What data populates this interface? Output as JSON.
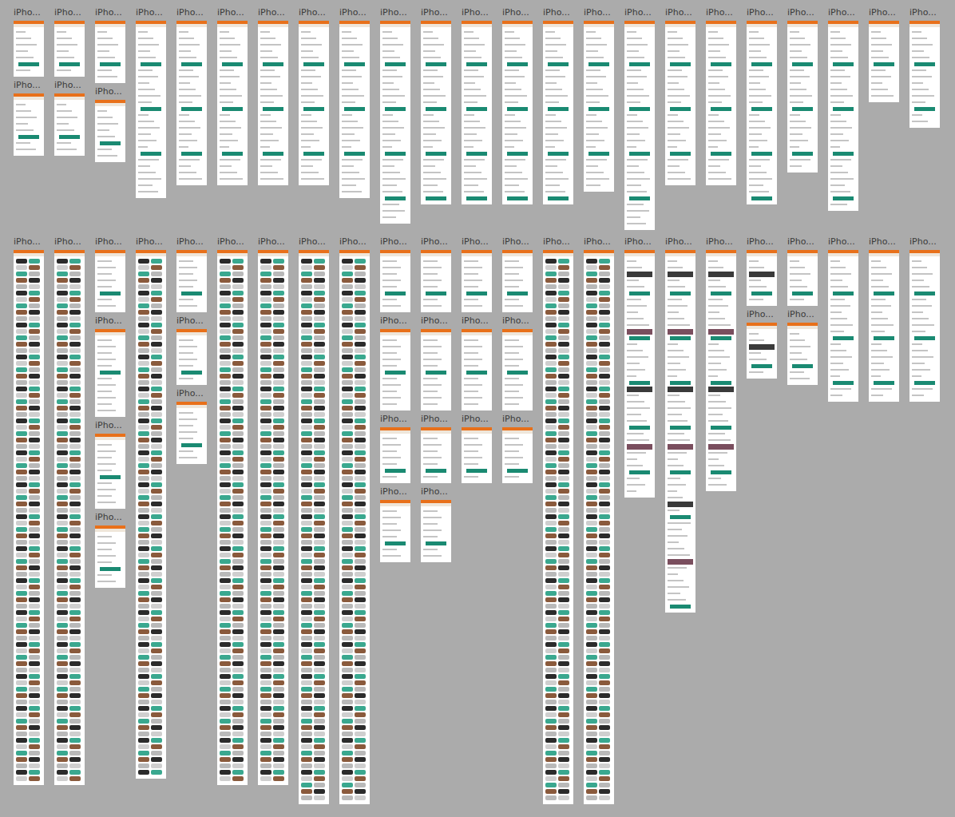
{
  "rows": [
    {
      "columns": [
        {
          "artboards": [
            {
              "label": "iPho...",
              "kind": "form",
              "items": 7
            },
            {
              "label": "iPho...",
              "kind": "form",
              "items": 8
            }
          ]
        },
        {
          "artboards": [
            {
              "label": "iPho...",
              "kind": "form",
              "items": 7
            },
            {
              "label": "iPho...",
              "kind": "form",
              "items": 8
            }
          ]
        },
        {
          "artboards": [
            {
              "label": "iPho...",
              "kind": "form",
              "items": 8
            },
            {
              "label": "iPho...",
              "kind": "form",
              "items": 8
            }
          ]
        },
        {
          "artboards": [
            {
              "label": "iPho...",
              "kind": "form",
              "items": 26
            }
          ]
        },
        {
          "artboards": [
            {
              "label": "iPho...",
              "kind": "form",
              "items": 24
            }
          ]
        },
        {
          "artboards": [
            {
              "label": "iPho...",
              "kind": "form",
              "items": 24
            }
          ]
        },
        {
          "artboards": [
            {
              "label": "iPho...",
              "kind": "form",
              "items": 24
            }
          ]
        },
        {
          "artboards": [
            {
              "label": "iPho...",
              "kind": "form",
              "items": 24
            }
          ]
        },
        {
          "artboards": [
            {
              "label": "iPho...",
              "kind": "form",
              "items": 26
            }
          ]
        },
        {
          "artboards": [
            {
              "label": "iPho...",
              "kind": "form",
              "items": 30
            }
          ]
        },
        {
          "artboards": [
            {
              "label": "iPho...",
              "kind": "form",
              "items": 27
            }
          ]
        },
        {
          "artboards": [
            {
              "label": "iPho...",
              "kind": "form",
              "items": 27
            }
          ]
        },
        {
          "artboards": [
            {
              "label": "iPho...",
              "kind": "form",
              "items": 27
            }
          ]
        },
        {
          "artboards": [
            {
              "label": "iPho...",
              "kind": "form",
              "items": 27
            }
          ]
        },
        {
          "artboards": [
            {
              "label": "iPho...",
              "kind": "form",
              "items": 25
            }
          ]
        },
        {
          "artboards": [
            {
              "label": "iPho...",
              "kind": "form",
              "items": 31
            }
          ]
        },
        {
          "artboards": [
            {
              "label": "iPho...",
              "kind": "form",
              "items": 24
            }
          ]
        },
        {
          "artboards": [
            {
              "label": "iPho...",
              "kind": "form",
              "items": 24
            }
          ]
        },
        {
          "artboards": [
            {
              "label": "iPho...",
              "kind": "form",
              "items": 27
            }
          ]
        },
        {
          "artboards": [
            {
              "label": "iPho...",
              "kind": "form",
              "items": 22
            }
          ]
        },
        {
          "artboards": [
            {
              "label": "iPho...",
              "kind": "form",
              "items": 28
            }
          ]
        },
        {
          "artboards": [
            {
              "label": "iPho...",
              "kind": "form",
              "items": 11
            }
          ]
        },
        {
          "artboards": [
            {
              "label": "iPho...",
              "kind": "form",
              "items": 15
            }
          ]
        }
      ]
    },
    {
      "columns": [
        {
          "artboards": [
            {
              "label": "iPho...",
              "kind": "grid",
              "items": 82
            }
          ]
        },
        {
          "artboards": [
            {
              "label": "iPho...",
              "kind": "grid",
              "items": 82
            }
          ]
        },
        {
          "artboards": [
            {
              "label": "iPho...",
              "kind": "menu",
              "items": 8
            },
            {
              "label": "iPho...",
              "kind": "menu",
              "items": 12
            },
            {
              "label": "iPho...",
              "kind": "menu",
              "items": 10
            },
            {
              "label": "iPho...",
              "kind": "menu",
              "items": 8
            }
          ]
        },
        {
          "artboards": [
            {
              "label": "iPho...",
              "kind": "grid",
              "items": 81
            }
          ]
        },
        {
          "artboards": [
            {
              "label": "iPho...",
              "kind": "menu",
              "items": 8
            },
            {
              "label": "iPho...",
              "kind": "menu",
              "items": 7
            },
            {
              "label": "iPho...",
              "kind": "menu",
              "items": 8
            }
          ]
        },
        {
          "artboards": [
            {
              "label": "iPho...",
              "kind": "grid",
              "items": 82
            }
          ]
        },
        {
          "artboards": [
            {
              "label": "iPho...",
              "kind": "grid",
              "items": 82
            }
          ]
        },
        {
          "artboards": [
            {
              "label": "iPho...",
              "kind": "grid",
              "items": 85
            }
          ]
        },
        {
          "artboards": [
            {
              "label": "iPho...",
              "kind": "grid",
              "items": 85
            }
          ]
        },
        {
          "artboards": [
            {
              "label": "iPho...",
              "kind": "menu",
              "items": 8
            },
            {
              "label": "iPho...",
              "kind": "menu",
              "items": 11
            },
            {
              "label": "iPho...",
              "kind": "menu",
              "items": 7
            },
            {
              "label": "iPho...",
              "kind": "menu",
              "items": 8
            }
          ]
        },
        {
          "artboards": [
            {
              "label": "iPho...",
              "kind": "menu",
              "items": 8
            },
            {
              "label": "iPho...",
              "kind": "menu",
              "items": 11
            },
            {
              "label": "iPho...",
              "kind": "menu",
              "items": 7
            },
            {
              "label": "iPho...",
              "kind": "menu",
              "items": 8
            }
          ]
        },
        {
          "artboards": [
            {
              "label": "iPho...",
              "kind": "menu",
              "items": 8
            },
            {
              "label": "iPho...",
              "kind": "menu",
              "items": 11
            },
            {
              "label": "iPho...",
              "kind": "menu",
              "items": 7
            }
          ]
        },
        {
          "artboards": [
            {
              "label": "iPho...",
              "kind": "menu",
              "items": 8
            },
            {
              "label": "iPho...",
              "kind": "menu",
              "items": 11
            },
            {
              "label": "iPho...",
              "kind": "menu",
              "items": 7
            }
          ]
        },
        {
          "artboards": [
            {
              "label": "iPho...",
              "kind": "grid",
              "items": 85
            }
          ]
        },
        {
          "artboards": [
            {
              "label": "iPho...",
              "kind": "grid",
              "items": 85
            }
          ]
        },
        {
          "artboards": [
            {
              "label": "iPho...",
              "kind": "product",
              "items": 37
            }
          ]
        },
        {
          "artboards": [
            {
              "label": "iPho...",
              "kind": "product",
              "items": 55
            }
          ]
        },
        {
          "artboards": [
            {
              "label": "iPho...",
              "kind": "product",
              "items": 36
            }
          ]
        },
        {
          "artboards": [
            {
              "label": "iPho...",
              "kind": "product",
              "items": 7
            },
            {
              "label": "iPho...",
              "kind": "product",
              "items": 7
            }
          ]
        },
        {
          "artboards": [
            {
              "label": "iPho...",
              "kind": "form",
              "items": 7
            },
            {
              "label": "iPho...",
              "kind": "form",
              "items": 8
            }
          ]
        },
        {
          "artboards": [
            {
              "label": "iPho...",
              "kind": "form",
              "items": 22
            }
          ]
        },
        {
          "artboards": [
            {
              "label": "iPho...",
              "kind": "form",
              "items": 22
            }
          ]
        },
        {
          "artboards": [
            {
              "label": "iPho...",
              "kind": "form",
              "items": 22
            }
          ]
        }
      ]
    }
  ]
}
